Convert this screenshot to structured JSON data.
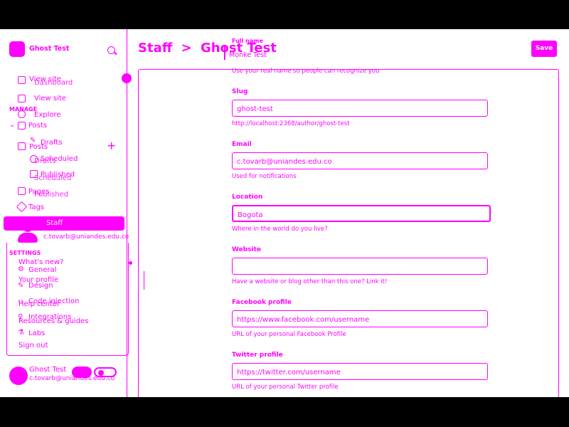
{
  "sidebar": {
    "site_title": "Ghost Test",
    "nav_main": [
      {
        "label": "View site"
      },
      {
        "label": "Dashboard"
      },
      {
        "label": "View site"
      },
      {
        "label": "Explore"
      }
    ],
    "manage_label": "MANAGE",
    "posts": {
      "label": "Posts",
      "sub": [
        "Drafts",
        "Scheduled",
        "Published"
      ]
    },
    "ghost_overlay": [
      "Posts",
      "Drafts",
      "Scheduled",
      "Published"
    ],
    "pages_label": "Pages",
    "tags_label": "Tags",
    "staff_label": "Staff",
    "user_email": "c.tovarb@uniandes.edu.co",
    "settings_label": "SETTINGS",
    "settings_items": [
      "General",
      "Design",
      "Code injection",
      "Integrations",
      "Labs"
    ],
    "menu_items": [
      "What's new?",
      "Your profile",
      "Help center",
      "Resources & guides",
      "Sign out"
    ],
    "footer_name": "Ghost Test",
    "footer_email": "c.tovarb@uniandes.edu.co"
  },
  "header": {
    "breadcrumb_parent": "Staff",
    "breadcrumb_sep": ">",
    "breadcrumb_current": "Ghost Test",
    "save_label": "Save"
  },
  "form": {
    "full_name": {
      "label": "Full name",
      "value": "Monke Test"
    },
    "name_help": "Use your real name so people can recognize you",
    "slug": {
      "label": "Slug",
      "value": "ghost-test",
      "help": "http://localhost:2368/author/ghost-test"
    },
    "email": {
      "label": "Email",
      "value": "c.tovarb@uniandes.edu.co",
      "help": "Used for notifications"
    },
    "location": {
      "label": "Location",
      "value": "Bogota",
      "help": "Where in the world do you live?"
    },
    "website": {
      "label": "Website",
      "value": "",
      "help": "Have a website or blog other than this one? Link it!"
    },
    "facebook": {
      "label": "Facebook profile",
      "value": "https://www.facebook.com/username",
      "help": "URL of your personal Facebook Profile"
    },
    "twitter": {
      "label": "Twitter profile",
      "value": "https://twitter.com/username",
      "help": "URL of your personal Twitter profile"
    }
  },
  "colors": {
    "accent": "#ff00ff",
    "background": "#ffffff",
    "letterbox": "#000000"
  },
  "icons": [
    "ghost-logo-icon",
    "search-icon",
    "home-icon",
    "window-icon",
    "globe-icon",
    "chevron-down-icon",
    "edit-icon",
    "clock-icon",
    "publish-icon",
    "pages-icon",
    "tag-icon",
    "avatar",
    "gear-icon",
    "brush-icon",
    "code-icon",
    "plug-icon",
    "flask-icon",
    "plus-icon",
    "toggle-switch"
  ]
}
